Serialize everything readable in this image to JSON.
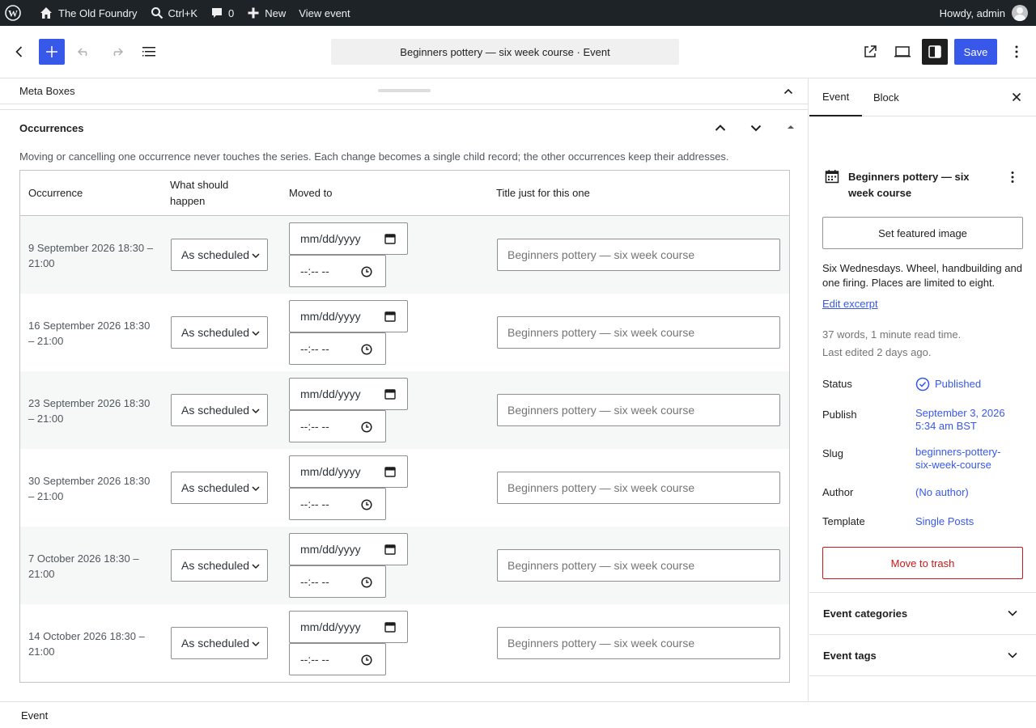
{
  "admin_bar": {
    "site_name": "The Old Foundry",
    "search_shortcut": "Ctrl+K",
    "comments_count": "0",
    "new_label": "New",
    "view_label": "View event",
    "greeting": "Howdy, admin"
  },
  "header": {
    "document_title": "Beginners pottery — six week course · Event",
    "save_label": "Save"
  },
  "meta_boxes": {
    "title": "Meta Boxes"
  },
  "occurrences": {
    "title": "Occurrences",
    "description": "Moving or cancelling one occurrence never touches the series. Each change becomes a single child record; the other occurrences keep their addresses.",
    "columns": [
      "Occurrence",
      "What should happen",
      "Moved to",
      "Title just for this one"
    ],
    "date_placeholder": "mm/dd/yyyy",
    "time_placeholder": "--:-- --",
    "rows": [
      {
        "occurrence": "9 September 2026 18:30 – 21:00",
        "action": "As scheduled",
        "title_placeholder": "Beginners pottery — six week course"
      },
      {
        "occurrence": "16 September 2026 18:30 – 21:00",
        "action": "As scheduled",
        "title_placeholder": "Beginners pottery — six week course"
      },
      {
        "occurrence": "23 September 2026 18:30 – 21:00",
        "action": "As scheduled",
        "title_placeholder": "Beginners pottery — six week course"
      },
      {
        "occurrence": "30 September 2026 18:30 – 21:00",
        "action": "As scheduled",
        "title_placeholder": "Beginners pottery — six week course"
      },
      {
        "occurrence": "7 October 2026 18:30 – 21:00",
        "action": "As scheduled",
        "title_placeholder": "Beginners pottery — six week course"
      },
      {
        "occurrence": "14 October 2026 18:30 – 21:00",
        "action": "As scheduled",
        "title_placeholder": "Beginners pottery — six week course"
      }
    ]
  },
  "footer": {
    "breadcrumb": "Event"
  },
  "sidebar": {
    "tabs": [
      "Event",
      "Block"
    ],
    "post_title": "Beginners pottery — six week course",
    "featured_image_label": "Set featured image",
    "excerpt": "Six Wednesdays. Wheel, handbuilding and one firing. Places are limited to eight.",
    "edit_excerpt_label": "Edit excerpt",
    "word_count": "37 words, 1 minute read time.",
    "last_edited": "Last edited 2 days ago.",
    "status_label": "Status",
    "status_value": "Published",
    "publish_label": "Publish",
    "publish_value": "September 3, 2026 5:34 am BST",
    "slug_label": "Slug",
    "slug_value": "beginners-pottery-six-week-course",
    "author_label": "Author",
    "author_value": "(No author)",
    "template_label": "Template",
    "template_value": "Single Posts",
    "trash_label": "Move to trash",
    "panels": [
      "Event categories",
      "Event tags"
    ]
  },
  "colors": {
    "accent": "#3858e9",
    "admin_bar": "#1d2327",
    "danger": "#cc1818"
  }
}
